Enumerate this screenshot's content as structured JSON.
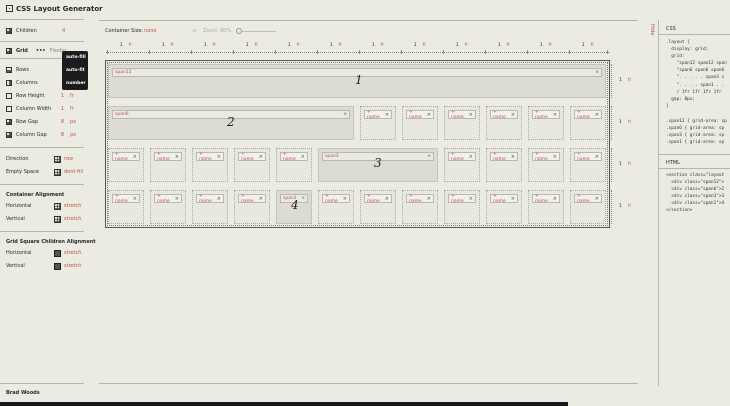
{
  "app": {
    "title": "CSS Layout Generator",
    "author": "Brad Woods"
  },
  "left": {
    "children": {
      "label": "Children",
      "value": "4"
    },
    "modes": {
      "grid": "Grid",
      "flexbox": "Flexbo"
    },
    "dropdown": [
      "auto-fill",
      "auto-fit",
      "number"
    ],
    "rows": {
      "label": "Rows"
    },
    "columns": {
      "label": "Columns"
    },
    "row_height": {
      "label": "Row Height",
      "value": "1",
      "unit": "fr"
    },
    "column_width": {
      "label": "Column Width",
      "value": "1",
      "unit": "fr"
    },
    "row_gap": {
      "label": "Row Gap",
      "value": "8",
      "unit": "px"
    },
    "column_gap": {
      "label": "Column Gap",
      "value": "8",
      "unit": "px"
    },
    "direction": {
      "label": "Direction",
      "value": "row"
    },
    "empty_space": {
      "label": "Empty Space",
      "value": "dont-fill"
    },
    "container_alignment": {
      "title": "Container Alignment",
      "horizontal": {
        "label": "Horizontal",
        "value": "stretch"
      },
      "vertical": {
        "label": "Vertical",
        "value": "stretch"
      }
    },
    "children_alignment": {
      "title": "Grid Square Children Alignment",
      "horizontal": {
        "label": "Horizontal",
        "value": "stretch"
      },
      "vertical": {
        "label": "Vertical",
        "value": "stretch"
      }
    }
  },
  "toolbar": {
    "container_size_label": "Container Size:",
    "container_size_value": "none",
    "zoom_label": "Zoom",
    "zoom_value": "90%"
  },
  "grid": {
    "column_value": "1",
    "column_unit": "fr",
    "row_value": "1",
    "row_unit": "fr",
    "cell_label": "+ name",
    "close": "×",
    "spans": [
      {
        "name": "span12",
        "number": "1"
      },
      {
        "name": "span6",
        "number": "2"
      },
      {
        "name": "span3",
        "number": "3"
      },
      {
        "name": "span1",
        "number": "4"
      }
    ]
  },
  "right": {
    "hide": "Hide",
    "css_title": "CSS",
    "html_title": "HTML",
    "css_code": [
      ".layout {",
      "  display: grid;",
      "  grid:",
      "    \"span12 span12 span",
      "    \"span6 span6 span6",
      "    \". . . . . span3 s",
      "    \". . . . span1 . .",
      "    / 1fr 1fr 1fr 1fr",
      "  gap: 8px;",
      "}"
    ],
    "css_areas": [
      ".span12 { grid-area: sp",
      ".span6 { grid-area: sp",
      ".span3 { grid-area: sp",
      ".span1 { grid-area: sp"
    ],
    "html_code": [
      "<section class=\"layout",
      "  <div class=\"span12\">",
      "  <div class=\"span6\">2",
      "  <div class=\"span3\">3",
      "  <div class=\"span1\">4",
      "</section>"
    ]
  }
}
